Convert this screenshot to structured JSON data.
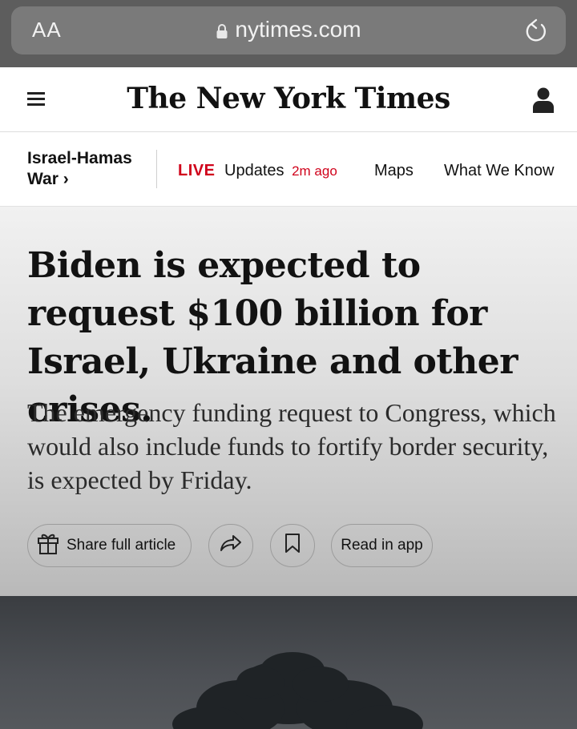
{
  "browser": {
    "text_size_label": "AA",
    "url": "nytimes.com"
  },
  "header": {
    "logo_text": "The New York Times"
  },
  "section_nav": {
    "section_title": "Israel-Hamas War ›",
    "live_tag": "LIVE",
    "updates_label": "Updates",
    "updated_time": "2m ago",
    "maps_label": "Maps",
    "what_we_know_label": "What We Know"
  },
  "article": {
    "headline": "Biden is expected to request $100 billion for Israel, Ukraine and other crises.",
    "summary": "The emergency funding request to Congress, which would also include funds to fortify border security, is expected by Friday.",
    "share_full_label": "Share full article",
    "read_in_app_label": "Read in app"
  },
  "colors": {
    "live_red": "#d0021b",
    "chrome_bg": "#5d5d5d"
  },
  "icons": {
    "menu": "hamburger-icon",
    "account": "person-icon",
    "lock": "lock-icon",
    "reload": "reload-icon",
    "gift": "gift-icon",
    "share": "share-arrow-icon",
    "bookmark": "bookmark-icon"
  }
}
